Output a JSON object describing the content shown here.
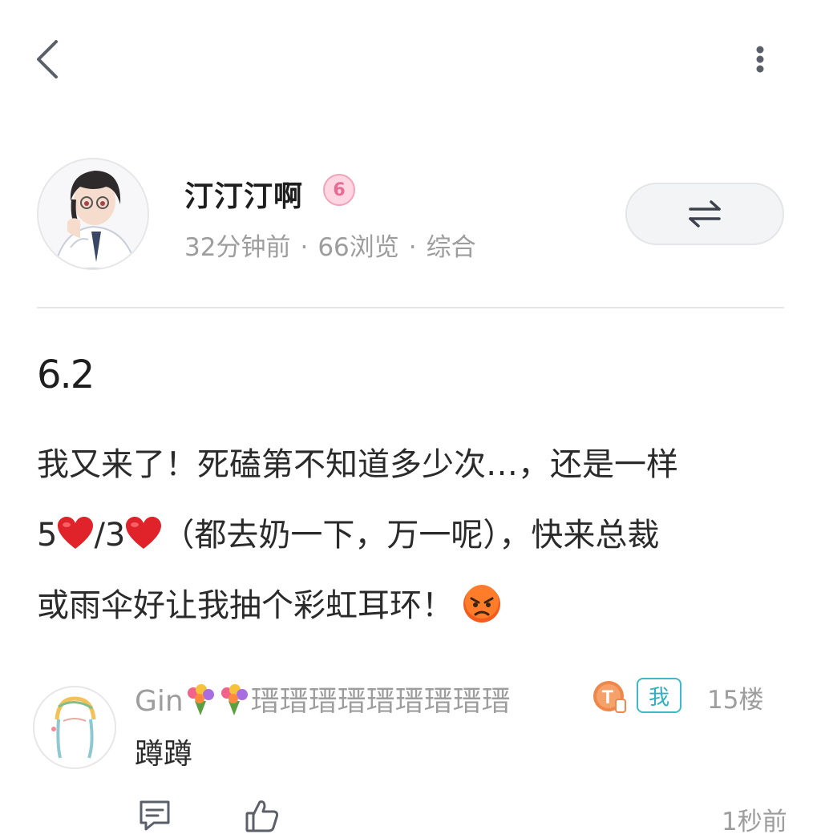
{
  "header": {
    "back_icon": "chevron-left-icon",
    "more_icon": "vertical-dots-icon"
  },
  "author": {
    "name": "汀汀汀啊",
    "level": "6",
    "time": "32分钟前",
    "views": "66浏览",
    "category": "综合",
    "separator": "·",
    "switch_icon": "switch-arrows-icon"
  },
  "post": {
    "title": "6.2",
    "line1": "我又来了！死磕第不知道多少次…，还是一样",
    "line2_part1": "5",
    "line2_part2": "/3",
    "line2_part3": "（都去奶一下，万一呢），快来总裁",
    "line3": "或雨伞好让我抽个彩虹耳环！",
    "heart_emoji": "❤️",
    "angry_emoji": "😡"
  },
  "comment": {
    "name_prefix": "Gin",
    "name_suffix": "瑨瑨瑨瑨瑨瑨瑨瑨瑨",
    "flower_emoji": "💐",
    "level": "T",
    "me_label": "我",
    "floor": "15楼",
    "text": "蹲蹲",
    "time": "1秒前",
    "reply_icon": "comment-icon",
    "like_icon": "thumbs-up-icon"
  },
  "colors": {
    "muted": "#9d9d9d",
    "badge_pink": "#f4a3bb",
    "me_teal": "#3fb8c7",
    "orange": "#f0874a"
  }
}
